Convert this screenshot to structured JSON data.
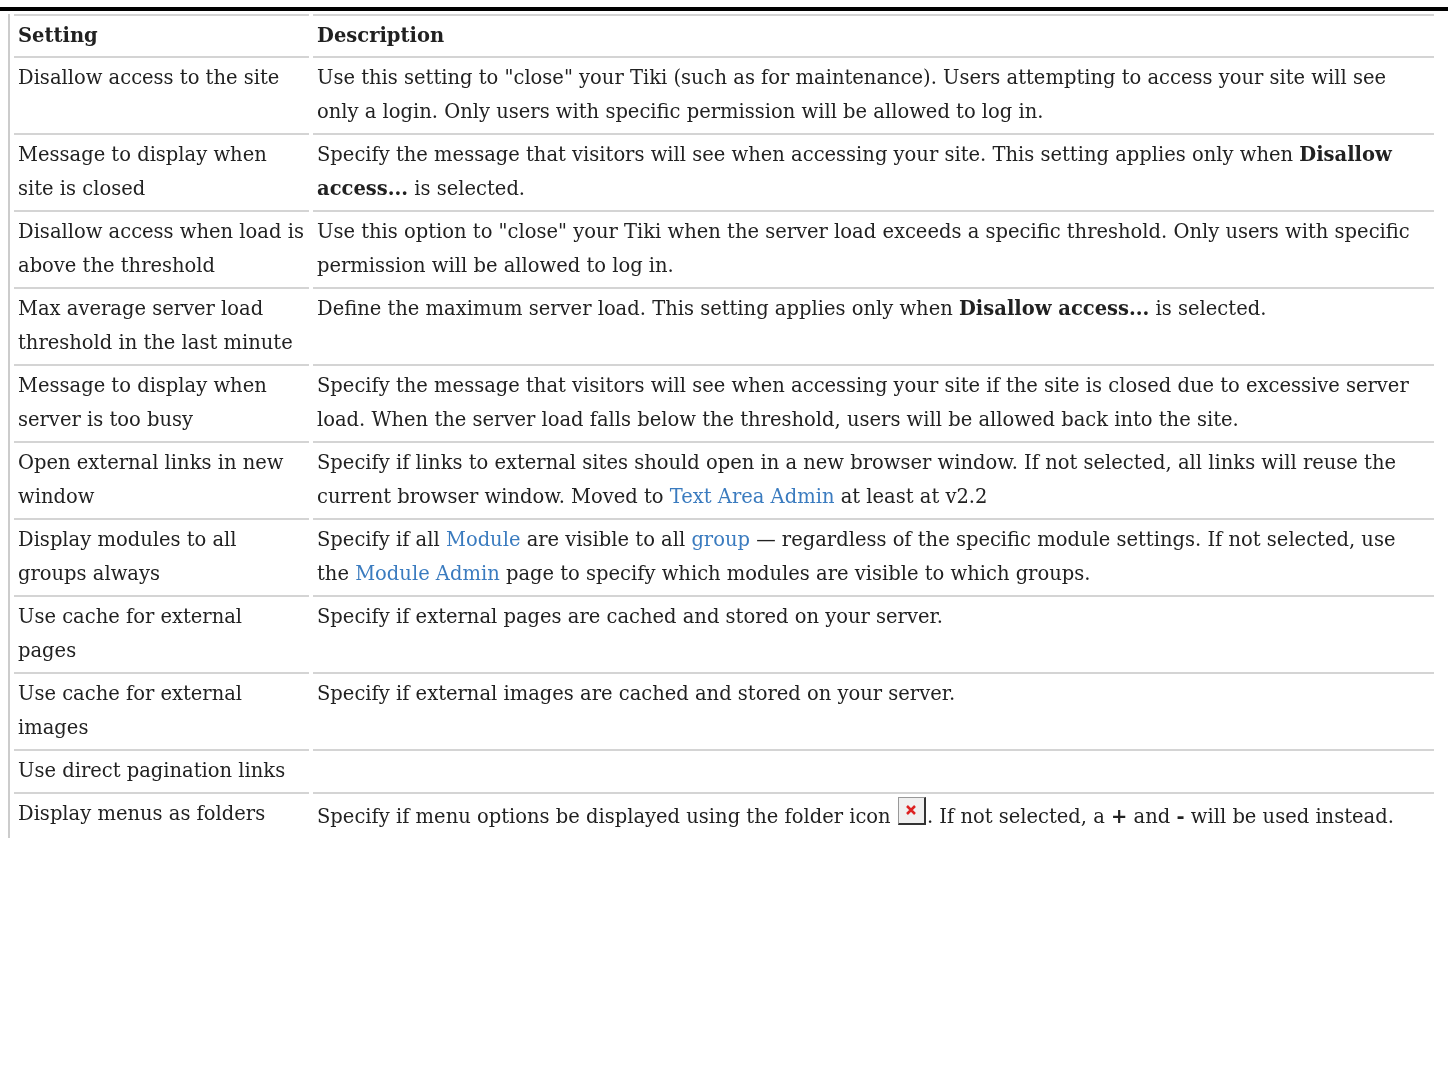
{
  "table": {
    "columns": [
      "Setting",
      "Description"
    ],
    "rows": [
      {
        "setting": "Disallow access to the site",
        "description": [
          {
            "kind": "text",
            "text": "Use this setting to \"close\" your Tiki (such as for maintenance). Users attempting to access your site will see only a login. Only users with specific permission will be allowed to log in."
          }
        ]
      },
      {
        "setting": "Message to display when site is closed",
        "description": [
          {
            "kind": "text",
            "text": "Specify the message that visitors will see when accessing your site. This setting applies only when **Disallow access...** is selected."
          }
        ]
      },
      {
        "setting": "Disallow access when load is above the threshold",
        "description": [
          {
            "kind": "text",
            "text": "Use this option to \"close\" your Tiki when the server load exceeds a specific threshold. Only users with specific permission will be allowed to log in."
          }
        ]
      },
      {
        "setting": "Max average server load threshold in the last minute",
        "description": [
          {
            "kind": "text",
            "text": "Define the maximum server load. This setting applies only when **Disallow access...** is selected."
          }
        ]
      },
      {
        "setting": "Message to display when server is too busy",
        "description": [
          {
            "kind": "text",
            "text": "Specify the message that visitors will see when accessing your site if the site is closed due to excessive server load. When the server load falls below the threshold, users will be allowed back into the site."
          }
        ]
      },
      {
        "setting": "Open external links in new window",
        "description": [
          {
            "kind": "text",
            "text": "Specify if links to external sites should open in a new browser window. If not selected, all links will reuse the current browser window. Moved to "
          },
          {
            "kind": "link",
            "text": "Text Area Admin"
          },
          {
            "kind": "text",
            "text": " at least at v2.2"
          }
        ]
      },
      {
        "setting": "Display modules to all groups always",
        "description": [
          {
            "kind": "text",
            "text": "Specify if all "
          },
          {
            "kind": "link",
            "text": "Module"
          },
          {
            "kind": "text",
            "text": " are visible to all "
          },
          {
            "kind": "link",
            "text": "group"
          },
          {
            "kind": "text",
            "text": " — regardless of the specific module settings. If not selected, use the "
          },
          {
            "kind": "link",
            "text": "Module Admin"
          },
          {
            "kind": "text",
            "text": " page to specify which modules are visible to which groups."
          }
        ]
      },
      {
        "setting": "Use cache for external pages",
        "description": [
          {
            "kind": "text",
            "text": "Specify if external pages are cached and stored on your server."
          }
        ]
      },
      {
        "setting": "Use cache for external images",
        "description": [
          {
            "kind": "text",
            "text": "Specify if external images are cached and stored on your server."
          }
        ]
      },
      {
        "setting": "Use direct pagination links",
        "description": []
      },
      {
        "setting": "Display menus as folders",
        "description": [
          {
            "kind": "text",
            "text": "Specify if menu options be displayed using the folder icon "
          },
          {
            "kind": "icon"
          },
          {
            "kind": "text",
            "text": ". If not selected, a **+** and **-** will be used instead."
          }
        ]
      }
    ]
  }
}
